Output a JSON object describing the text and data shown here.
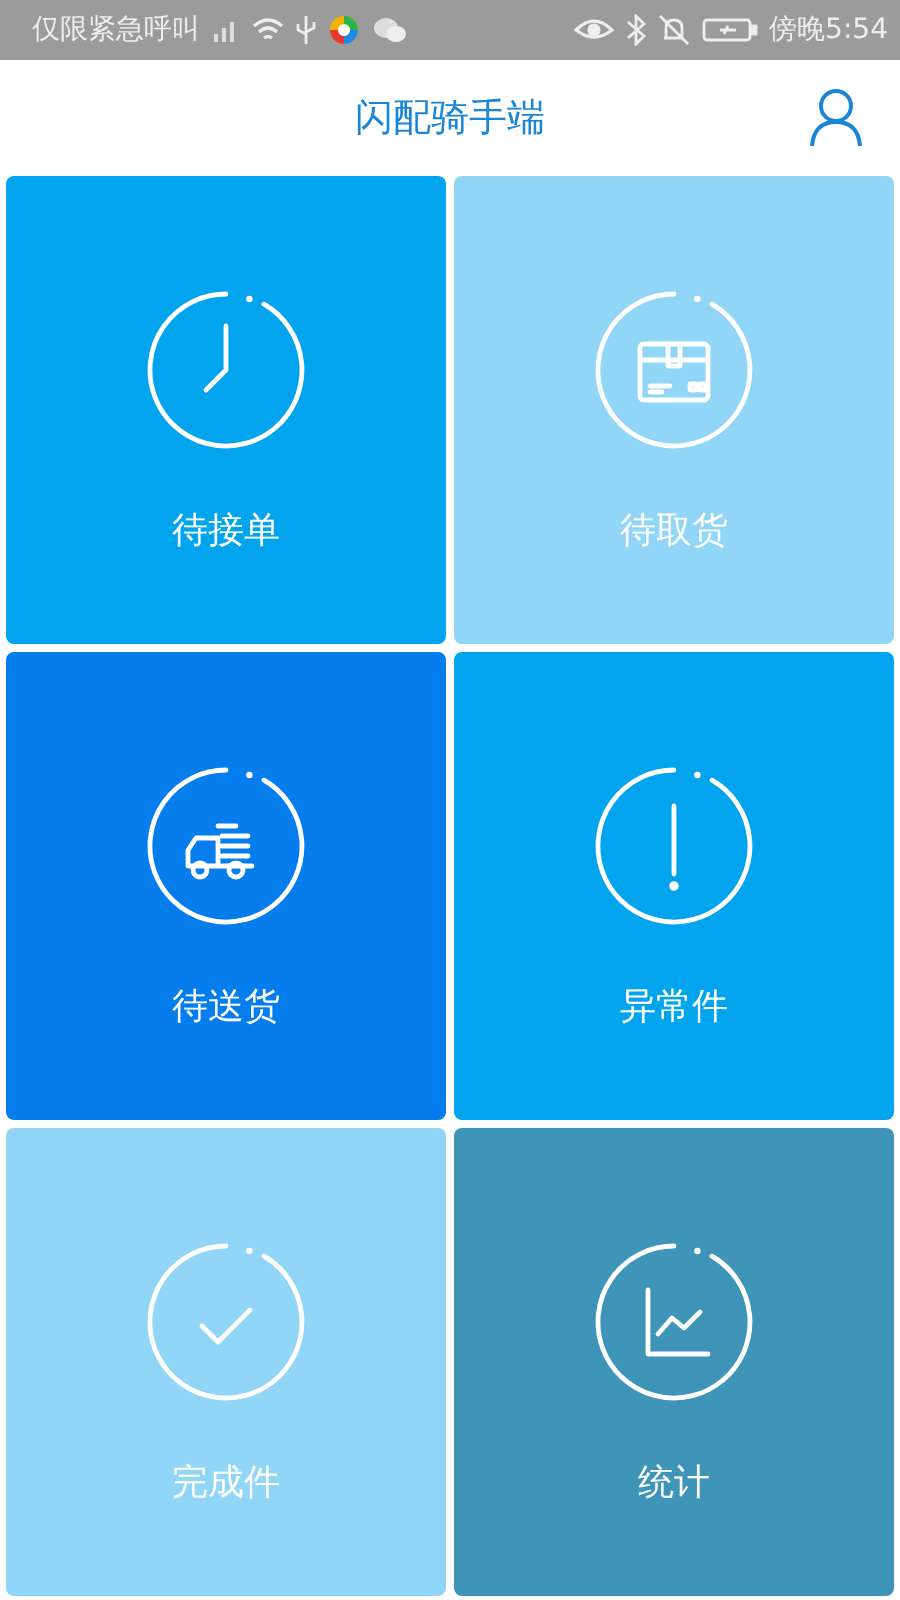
{
  "status_bar": {
    "carrier": "仅限紧急呼叫",
    "time": "傍晚5:54"
  },
  "header": {
    "title": "闪配骑手端"
  },
  "tiles": [
    {
      "label": "待接单",
      "kind": "clock",
      "color": "#03a4ee"
    },
    {
      "label": "待取货",
      "kind": "box",
      "color": "#91d5f7"
    },
    {
      "label": "待送货",
      "kind": "truck",
      "color": "#057ded"
    },
    {
      "label": "异常件",
      "kind": "alert",
      "color": "#03a4ee"
    },
    {
      "label": "完成件",
      "kind": "check",
      "color": "#91d5f7"
    },
    {
      "label": "统计",
      "kind": "chart",
      "color": "#3e95b8"
    }
  ]
}
